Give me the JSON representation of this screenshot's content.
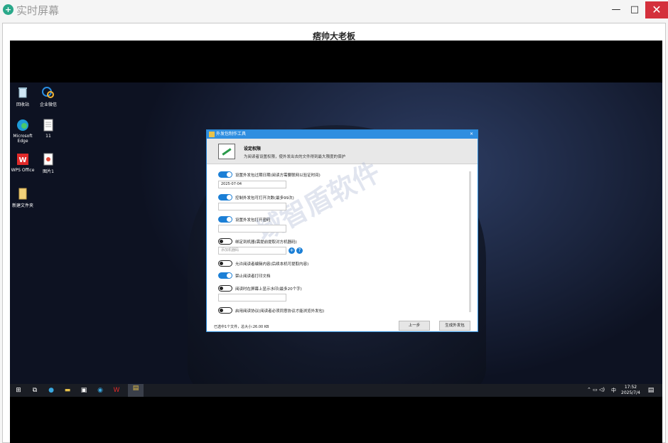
{
  "window": {
    "title": "实时屏幕",
    "icon": "plus-circle-icon",
    "controls": {
      "minimize": "—",
      "maximize": "□",
      "close": "✕"
    }
  },
  "remote": {
    "name": "痞帅大老板"
  },
  "desktop": {
    "icons": [
      {
        "label": "回收站",
        "icon": "recycle-bin-icon"
      },
      {
        "label": "企业微信",
        "icon": "wecom-icon"
      },
      {
        "label": "Microsoft Edge",
        "icon": "edge-icon"
      },
      {
        "label": "11",
        "icon": "file-icon"
      },
      {
        "label": "WPS Office",
        "icon": "wps-icon"
      },
      {
        "label": "图片1",
        "icon": "image-file-icon"
      },
      {
        "label": "新建文件夹",
        "icon": "folder-icon"
      }
    ]
  },
  "dialog": {
    "title": "外发包制作工具",
    "close": "✕",
    "header_title": "设定权限",
    "header_subtitle": "为阅读者设置权限，使外发出去的文件得到最大限度的保护",
    "options": [
      {
        "label": "设置外发包过期日期(阅读方需要联网以验证时间)",
        "on": true
      },
      {
        "label": "控制外发包可打开次数(最多99次)",
        "on": true
      },
      {
        "label": "设置外发包打开密码",
        "on": true
      },
      {
        "label": "绑定到机器(需提前提取对方机器码)",
        "on": false
      },
      {
        "label": "允许阅读者编辑内容(后续本机可提取内容)",
        "on": false
      },
      {
        "label": "禁止阅读者打印文档",
        "on": true
      },
      {
        "label": "阅读时在屏幕上显示水印(最多20个字)",
        "on": false
      },
      {
        "label": "启用阅读协议(阅读者必须同意协议才能浏览外发包)",
        "on": false
      }
    ],
    "expiry_value": "2025-07-04",
    "machine_code_placeholder": "添加机器码",
    "watermark": "域智盾软件",
    "status": "已选中1个文件，总大小:26.00 KB",
    "back_button": "上一步",
    "generate_button": "生成外发包"
  },
  "taskbar": {
    "tray_text": "中",
    "time": "17:52",
    "date": "2025/7/4"
  },
  "colors": {
    "accent": "#1b7fd6",
    "close": "#d4303c",
    "dialog_title": "#2f8ee0"
  }
}
